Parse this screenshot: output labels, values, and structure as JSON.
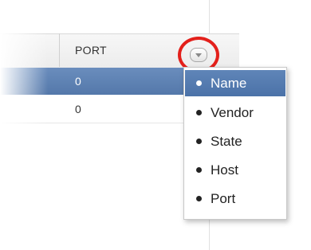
{
  "grid": {
    "column_header": "PORT",
    "rows": [
      {
        "port": "0",
        "selected": true
      },
      {
        "port": "0",
        "selected": false
      }
    ]
  },
  "column_menu": {
    "trigger_icon": "chevron-down-icon",
    "highlight_color": "#e3201b",
    "items": [
      {
        "label": "Name",
        "active": true
      },
      {
        "label": "Vendor",
        "active": false
      },
      {
        "label": "State",
        "active": false
      },
      {
        "label": "Host",
        "active": false
      },
      {
        "label": "Port",
        "active": false
      }
    ]
  },
  "colors": {
    "selection": "#5478aa",
    "menu_active": "#4b72a8"
  }
}
